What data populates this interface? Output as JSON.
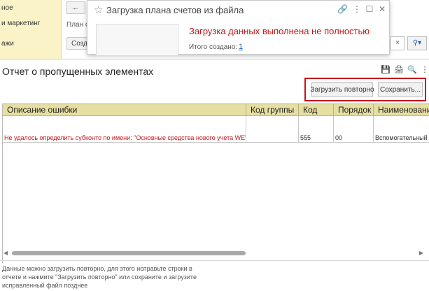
{
  "sidebar": {
    "items": [
      "ное",
      "и маркетинг",
      "ажи"
    ]
  },
  "background": {
    "field_label": "План сч",
    "create_button": "Созда"
  },
  "dialog": {
    "title": "Загрузка плана счетов из файла",
    "status": "Загрузка данных выполнена не полностью",
    "created_label": "Итого создано:",
    "created_count": "1"
  },
  "report": {
    "title": "Отчет о пропущенных элементах",
    "reload_button": "Загрузить повторно",
    "save_button": "Сохранить...",
    "columns": [
      "Описание ошибки",
      "Код группы",
      "Код",
      "Порядок",
      "Наименование"
    ],
    "rows": [
      {
        "description": "Не удалось определить субконто по имени: \"Основные средства нового учета WE\"",
        "group_code": "",
        "code": "555",
        "order": "00",
        "name": "Вспомогательный сч"
      }
    ],
    "hint": "Данные можно загрузить повторно, для этого исправьте строки в отчете и нажмите \"Загрузить повторно\" или сохраните и загрузите исправленный файл позднее"
  },
  "colors": {
    "accent_red": "#c2161b",
    "header_bg": "#e6dfa2",
    "sidebar_bg": "#fbf3c8",
    "link_blue": "#1a5fb4"
  }
}
